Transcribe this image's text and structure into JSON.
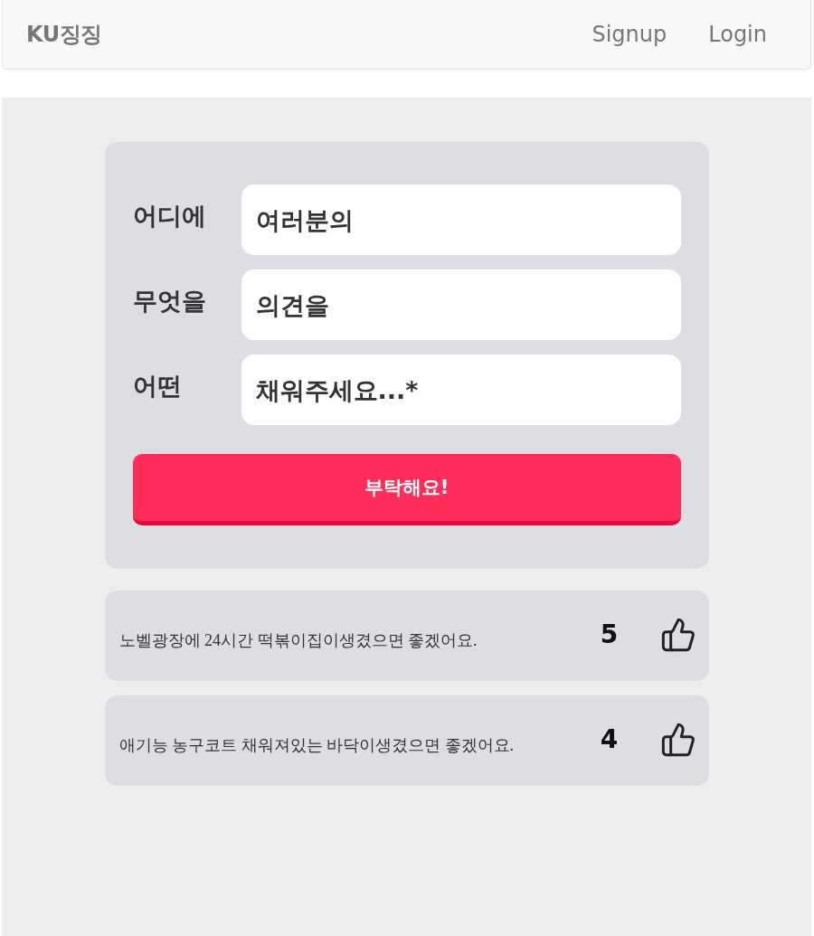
{
  "navbar": {
    "brand": "KU징징",
    "links": [
      {
        "label": "Signup"
      },
      {
        "label": "Login"
      }
    ]
  },
  "form": {
    "fields": [
      {
        "label": "어디에",
        "placeholder": "여러분의"
      },
      {
        "label": "무엇을",
        "placeholder": "의견을"
      },
      {
        "label": "어떤",
        "placeholder": "채워주세요...*"
      }
    ],
    "submit": "부탁해요!"
  },
  "posts": [
    {
      "text": "노벨광장에 24시간 떡볶이집이생겼으면 좋겠어요.",
      "likes": "5"
    },
    {
      "text": "애기능 농구코트 채워져있는 바닥이생겼으면 좋겠어요.",
      "likes": "4"
    }
  ]
}
